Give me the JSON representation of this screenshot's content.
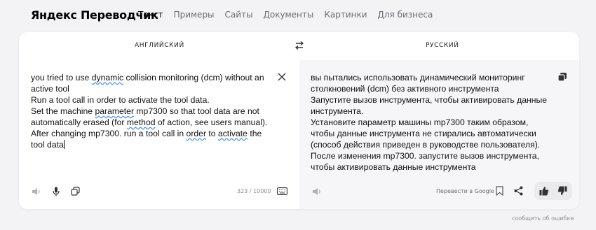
{
  "header": {
    "logo": "Яндекс Переводчик",
    "nav": [
      {
        "label": "Текст",
        "active": true
      },
      {
        "label": "Примеры",
        "active": false
      },
      {
        "label": "Сайты",
        "active": false
      },
      {
        "label": "Документы",
        "active": false
      },
      {
        "label": "Картинки",
        "active": false
      },
      {
        "label": "Для бизнеса",
        "active": false
      }
    ]
  },
  "languages": {
    "source": "АНГЛИЙСКИЙ",
    "target": "РУССКИЙ"
  },
  "source": {
    "segments": [
      {
        "text": "you tried to use ",
        "underline": false
      },
      {
        "text": "dynamic",
        "underline": true
      },
      {
        "text": " collision monitoring  (dcm) without an\nactive tool\nRun a tool call in order to activate the tool data.\nSet the machine ",
        "underline": false
      },
      {
        "text": "parameter",
        "underline": true
      },
      {
        "text": " mp7300 so that tool data are not\nautomatically erased (for ",
        "underline": false
      },
      {
        "text": "method",
        "underline": true
      },
      {
        "text": " of action, see users manual).\nAfter changing mp7300. run a tool call in ",
        "underline": false
      },
      {
        "text": "order",
        "underline": true
      },
      {
        "text": " to ",
        "underline": false
      },
      {
        "text": "activate",
        "underline": true
      },
      {
        "text": " the\ntool data",
        "underline": false
      }
    ],
    "char_count": "323 / 10000"
  },
  "target": {
    "text": "вы пытались использовать динамический мониторинг\nстолкновений (dcm) без активного инструмента\nЗапустите вызов инструмента, чтобы активировать данные\nинструмента.\nУстановите параметр машины mp7300 таким образом,\nчтобы данные инструмента не стирались автоматически\n(способ действия приведен в руководстве пользователя).\nПосле изменения mp7300. запустите вызов инструмента,\nчтобы активировать данные инструмента",
    "google_link": "Перевести в Google"
  },
  "footer": {
    "report": "сообщить об ошибке"
  },
  "icons": {
    "swap": "swap-arrows-icon",
    "clear": "close-icon",
    "copy": "copy-icon",
    "speaker": "speaker-icon",
    "mic": "microphone-icon",
    "copy_src": "copy-icon",
    "keyboard": "keyboard-icon",
    "bookmark": "bookmark-icon",
    "share": "share-icon",
    "like": "thumbs-up-icon",
    "dislike": "thumbs-down-icon"
  },
  "colors": {
    "background": "#f3f3f5",
    "underline": "#4a90e2",
    "muted": "#8a8a95"
  }
}
